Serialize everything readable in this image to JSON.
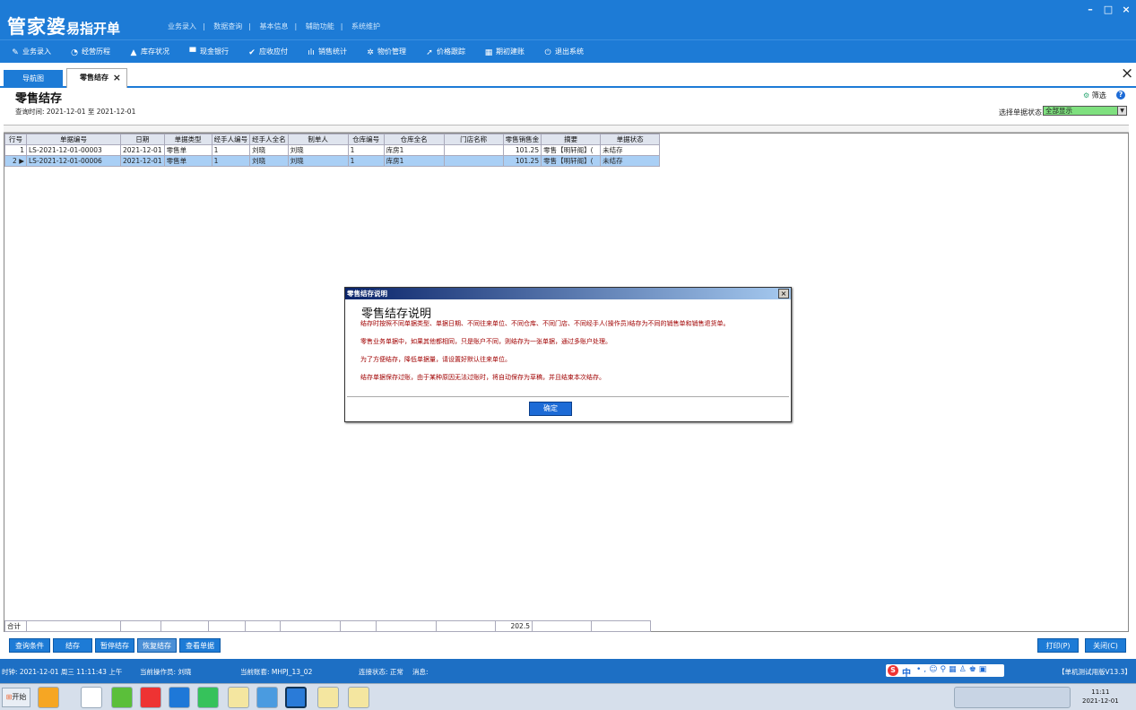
{
  "app": {
    "name": "管家婆",
    "subname": "易指开单",
    "top_menu": [
      "业务录入",
      "数据查询",
      "基本信息",
      "辅助功能",
      "系统维护"
    ],
    "window_controls": [
      "–",
      "□",
      "×"
    ]
  },
  "toolbar": [
    {
      "label": "业务录入",
      "icon": "pen-icon"
    },
    {
      "label": "经营历程",
      "icon": "clock-icon"
    },
    {
      "label": "库存状况",
      "icon": "house-icon"
    },
    {
      "label": "现金银行",
      "icon": "card-icon"
    },
    {
      "label": "应收应付",
      "icon": "check-icon"
    },
    {
      "label": "销售统计",
      "icon": "bar-chart-icon"
    },
    {
      "label": "物价管理",
      "icon": "gear-icon"
    },
    {
      "label": "价格跟踪",
      "icon": "arrow-icon"
    },
    {
      "label": "期初建账",
      "icon": "calc-icon"
    },
    {
      "label": "退出系统",
      "icon": "power-icon"
    }
  ],
  "tabs": {
    "nav": "导航图",
    "active": "零售结存",
    "close": "×"
  },
  "page": {
    "title": "零售结存",
    "query_time": "查询时间: 2021-12-01 至 2021-12-01",
    "filter": "筛选",
    "status_label": "选择单据状态",
    "status_value": "全部显示"
  },
  "table": {
    "headers": [
      "行号",
      "单据编号",
      "日期",
      "单据类型",
      "经手人编号",
      "经手人全名",
      "制单人",
      "仓库编号",
      "仓库全名",
      "门店名称",
      "零售销售金",
      "摘要",
      "单据状态"
    ],
    "rows": [
      [
        "1",
        "LS-2021-12-01-00003",
        "2021-12-01",
        "零售单",
        "1",
        "刘晓",
        "刘晓",
        "1",
        "库房1",
        "",
        "101.25",
        "零售【明轩阁】(",
        "未结存"
      ],
      [
        "2",
        "LS-2021-12-01-00006",
        "2021-12-01",
        "零售单",
        "1",
        "刘晓",
        "刘晓",
        "1",
        "库房1",
        "",
        "101.25",
        "零售【明轩阁】(",
        "未结存"
      ]
    ],
    "total_label": "合计",
    "total_amount": "202.5"
  },
  "buttons": [
    "查询条件",
    "结存",
    "暂停结存",
    "恢复结存",
    "查看单据"
  ],
  "right_buttons": [
    "打印(P)",
    "关闭(C)"
  ],
  "status": {
    "time": "时钟: 2021-12-01 周三 11:11:43 上午",
    "operator": "当前操作员: 刘晓",
    "account": "当前账套: MHPJ_13_02",
    "connection": "连接状态: 正常",
    "message": "消息:",
    "version": "【单机测试用版V13.3】"
  },
  "taskbar": {
    "start": "开始",
    "clock_time": "11:11",
    "clock_date": "2021-12-01"
  },
  "dialog": {
    "title": "零售结存说明",
    "heading": "零售结存说明",
    "lines": [
      "结存时按照不同单据类型、单据日期、不同往来单位、不同仓库、不同门店、不同经手人(操作员)结存为不同的销售单和销售退货单。",
      "零售业务单据中，如果其他都相同，只是账户不同，则结存为一张单据，通过多账户处理。",
      "为了方便结存，降低单据量，请设置好默认往来单位。",
      "结存单据保存过账，由于某种原因无法过账时，将自动保存为草稿，并且结束本次结存。"
    ],
    "ok": "确定",
    "close": "×"
  }
}
